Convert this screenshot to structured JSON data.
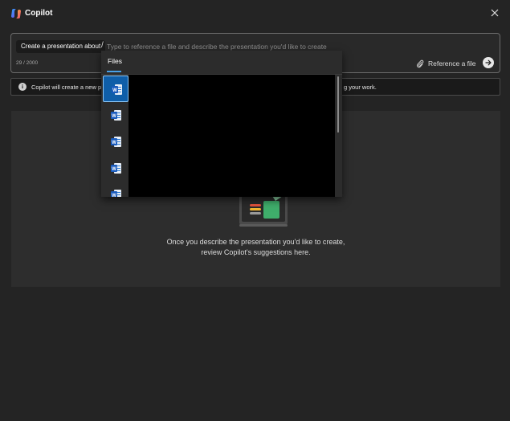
{
  "app": {
    "title": "Copilot"
  },
  "prompt": {
    "chip_label": "Create a presentation about",
    "slash": "/",
    "placeholder": "Type to reference a file and describe the presentation you'd like to create",
    "char_count": "29 / 2000",
    "reference_label": "Reference a file"
  },
  "info": {
    "text_left": "Copilot will create a new pr",
    "text_right": "g your work."
  },
  "preview": {
    "empty_line1": "Once you describe the presentation you'd like to create,",
    "empty_line2": "review Copilot's suggestions here."
  },
  "files_popup": {
    "tab_label": "Files",
    "items": [
      {
        "icon": "word-icon",
        "selected": true
      },
      {
        "icon": "word-icon",
        "selected": false
      },
      {
        "icon": "word-icon",
        "selected": false
      },
      {
        "icon": "word-icon",
        "selected": false
      },
      {
        "icon": "word-icon",
        "selected": false
      }
    ]
  },
  "colors": {
    "accent": "#0f5ea8",
    "tab_underline": "#4aa0e6",
    "background": "#242424",
    "panel": "#2d2d2d"
  }
}
